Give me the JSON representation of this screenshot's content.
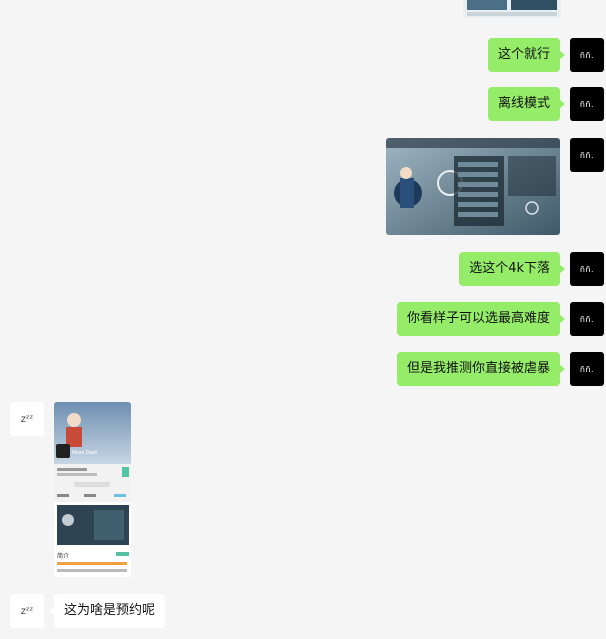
{
  "messages": [
    {
      "side": "right",
      "type": "text",
      "text": "这个就行"
    },
    {
      "side": "right",
      "type": "text",
      "text": "离线模式"
    },
    {
      "side": "right",
      "type": "image",
      "image": "game-settings-screenshot"
    },
    {
      "side": "right",
      "type": "text",
      "text": "选这个4k下落"
    },
    {
      "side": "right",
      "type": "text",
      "text": "你看样子可以选最高难度"
    },
    {
      "side": "right",
      "type": "text",
      "text": "但是我推测你直接被虐暴"
    },
    {
      "side": "left",
      "type": "image",
      "image": "game-store-page-screenshot"
    },
    {
      "side": "left",
      "type": "text",
      "text": "这为啥是预约呢"
    }
  ],
  "avatars": {
    "self_text": "ññ.",
    "other_text": "zᶻᶻ"
  },
  "thumb_texts": {
    "store_title": "Muse Dash",
    "store_section": "简介",
    "store_button": "预约"
  }
}
